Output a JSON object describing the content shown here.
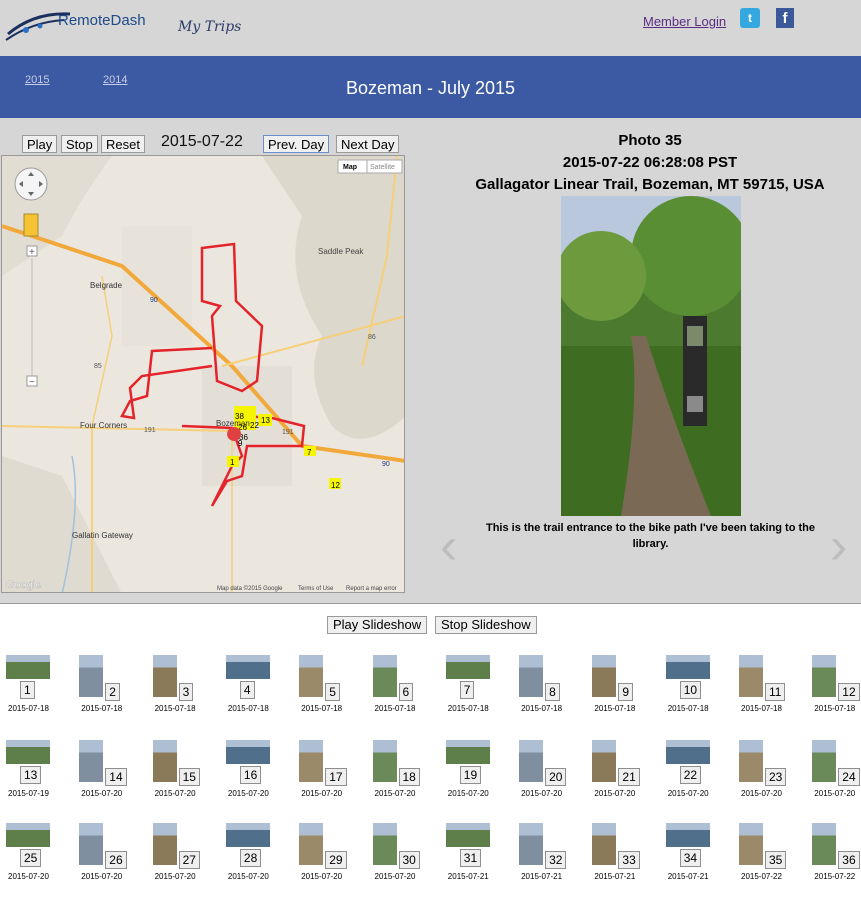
{
  "header": {
    "logo_text": "RemoteDash",
    "my_trips": "My Trips",
    "member_login": "Member Login",
    "twitter_icon": "t",
    "facebook_icon": "f"
  },
  "banner": {
    "years": [
      "2015",
      "2014"
    ],
    "title": "Bozeman - July 2015"
  },
  "controls": {
    "play": "Play",
    "stop": "Stop",
    "reset": "Reset",
    "date": "2015-07-22",
    "prev_day": "Prev. Day",
    "next_day": "Next Day"
  },
  "map": {
    "type_map": "Map",
    "type_satellite": "Satellite",
    "places": [
      "Belgrade",
      "Four Corners",
      "Bozeman",
      "Saddle Peak",
      "Gallatin Gateway"
    ],
    "road_shields": [
      "90",
      "86",
      "85",
      "191",
      "191",
      "90"
    ],
    "footer_google": "Google",
    "footer_data": "Map data ©2015 Google",
    "footer_terms": "Terms of Use",
    "footer_report": "Report a map error",
    "marker_labels": [
      "38",
      "26",
      "36",
      "22",
      "13",
      "12",
      "7",
      "1",
      "9"
    ],
    "route_color": "#e4232b",
    "marker_color": "#f5f500"
  },
  "photo": {
    "number": "Photo 35",
    "timestamp": "2015-07-22 06:28:08 PST",
    "location": "Gallagator Linear Trail, Bozeman, MT 59715, USA",
    "caption": "This is the trail entrance to the bike path I've been taking to the library.",
    "prev_icon": "‹",
    "next_icon": "›"
  },
  "slideshow": {
    "play": "Play Slideshow",
    "stop": "Stop Slideshow"
  },
  "thumbnails": [
    {
      "n": "1",
      "date": "2015-07-18"
    },
    {
      "n": "2",
      "date": "2015-07-18"
    },
    {
      "n": "3",
      "date": "2015-07-18"
    },
    {
      "n": "4",
      "date": "2015-07-18"
    },
    {
      "n": "5",
      "date": "2015-07-18"
    },
    {
      "n": "6",
      "date": "2015-07-18"
    },
    {
      "n": "7",
      "date": "2015-07-18"
    },
    {
      "n": "8",
      "date": "2015-07-18"
    },
    {
      "n": "9",
      "date": "2015-07-18"
    },
    {
      "n": "10",
      "date": "2015-07-18"
    },
    {
      "n": "11",
      "date": "2015-07-18"
    },
    {
      "n": "12",
      "date": "2015-07-18"
    },
    {
      "n": "13",
      "date": "2015-07-19"
    },
    {
      "n": "14",
      "date": "2015-07-20"
    },
    {
      "n": "15",
      "date": "2015-07-20"
    },
    {
      "n": "16",
      "date": "2015-07-20"
    },
    {
      "n": "17",
      "date": "2015-07-20"
    },
    {
      "n": "18",
      "date": "2015-07-20"
    },
    {
      "n": "19",
      "date": "2015-07-20"
    },
    {
      "n": "20",
      "date": "2015-07-20"
    },
    {
      "n": "21",
      "date": "2015-07-20"
    },
    {
      "n": "22",
      "date": "2015-07-20"
    },
    {
      "n": "23",
      "date": "2015-07-20"
    },
    {
      "n": "24",
      "date": "2015-07-20"
    },
    {
      "n": "25",
      "date": "2015-07-20"
    },
    {
      "n": "26",
      "date": "2015-07-20"
    },
    {
      "n": "27",
      "date": "2015-07-20"
    },
    {
      "n": "28",
      "date": "2015-07-20"
    },
    {
      "n": "29",
      "date": "2015-07-20"
    },
    {
      "n": "30",
      "date": "2015-07-20"
    },
    {
      "n": "31",
      "date": "2015-07-21"
    },
    {
      "n": "32",
      "date": "2015-07-21"
    },
    {
      "n": "33",
      "date": "2015-07-21"
    },
    {
      "n": "34",
      "date": "2015-07-21"
    },
    {
      "n": "35",
      "date": "2015-07-22"
    },
    {
      "n": "36",
      "date": "2015-07-22"
    }
  ]
}
